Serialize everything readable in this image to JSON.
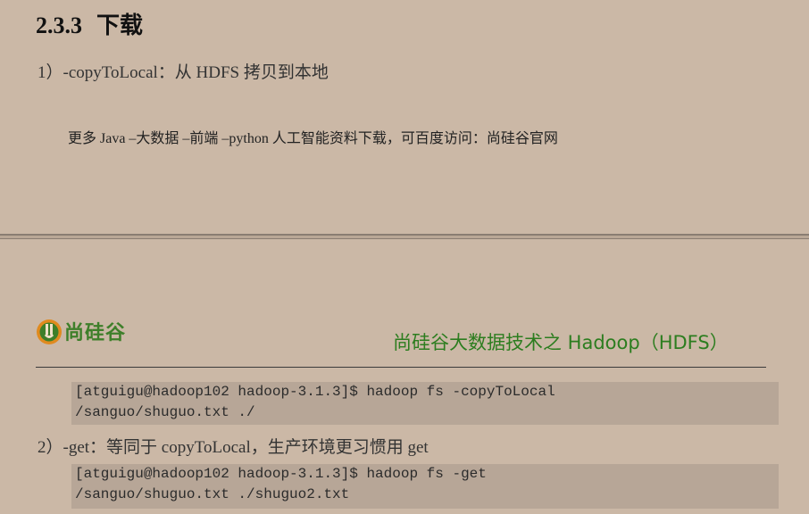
{
  "section": {
    "number": "2.3.3",
    "title": "下载"
  },
  "item1": {
    "text": "1）-copyToLocal：从 HDFS 拷贝到本地"
  },
  "promo": {
    "text": "更多 Java –大数据 –前端 –python 人工智能资料下载，可百度访问：尚硅谷官网"
  },
  "header": {
    "logo_text": "尚硅谷",
    "title": "尚硅谷大数据技术之 Hadoop（HDFS）",
    "accent_color": "#2c7d1f"
  },
  "code1": {
    "lines": [
      "[atguigu@hadoop102 hadoop-3.1.3]$ hadoop fs -copyToLocal",
      "/sanguo/shuguo.txt ./"
    ]
  },
  "item2": {
    "text": "2）-get：等同于 copyToLocal，生产环境更习惯用 get"
  },
  "code2": {
    "lines": [
      "[atguigu@hadoop102 hadoop-3.1.3]$ hadoop fs -get",
      "/sanguo/shuguo.txt ./shuguo2.txt"
    ]
  }
}
